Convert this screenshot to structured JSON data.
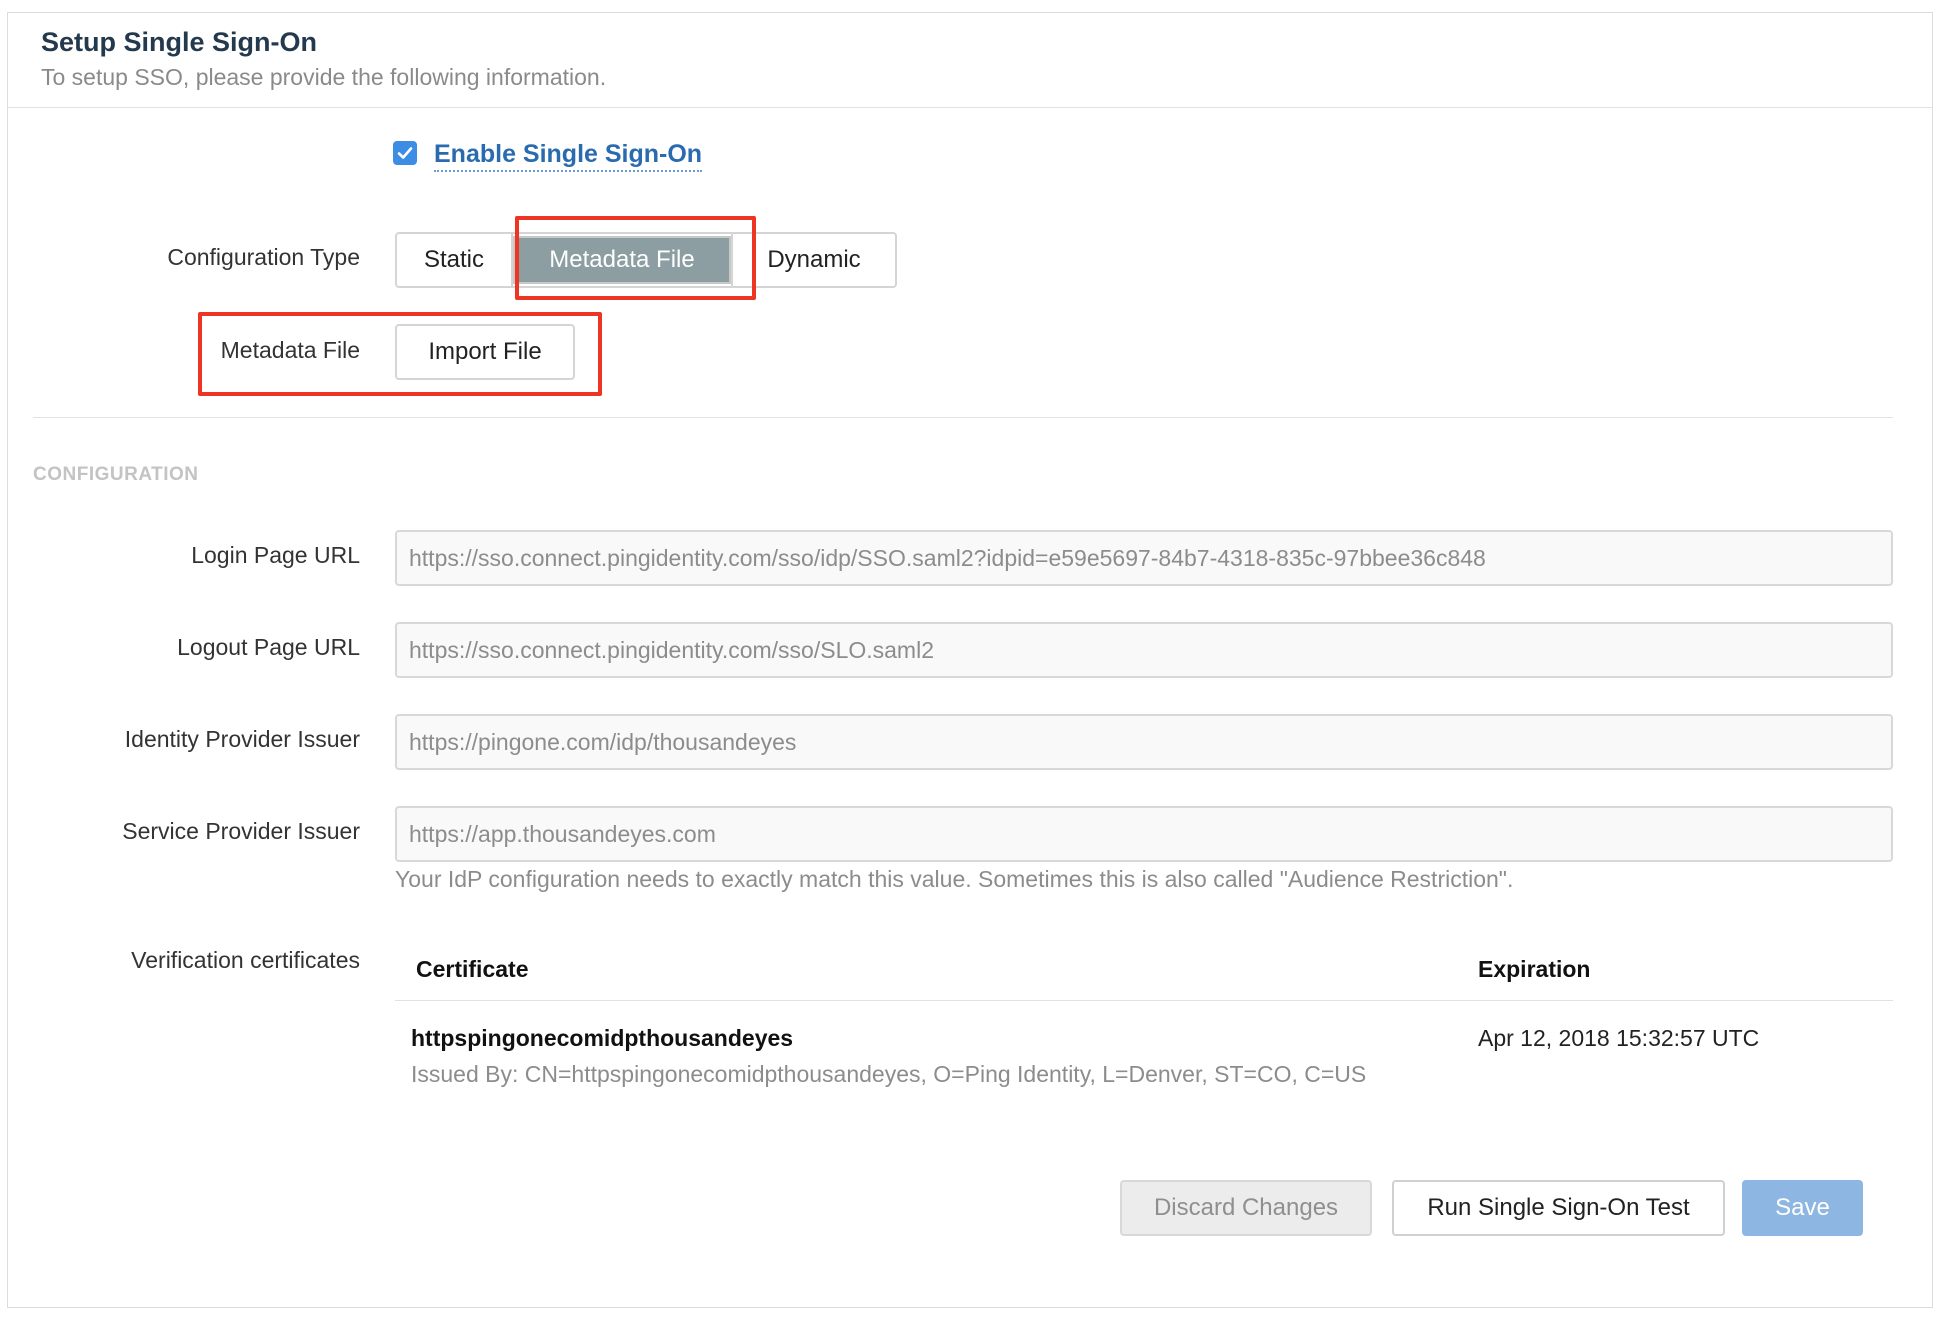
{
  "header": {
    "title": "Setup Single Sign-On",
    "subtitle": "To setup SSO, please provide the following information."
  },
  "enable_sso": {
    "label": "Enable Single Sign-On",
    "checked": true
  },
  "configuration_type": {
    "label": "Configuration Type",
    "options": [
      "Static",
      "Metadata File",
      "Dynamic"
    ],
    "selected": "Metadata File"
  },
  "metadata_file": {
    "label": "Metadata File",
    "button_label": "Import File"
  },
  "configuration": {
    "section_title": "CONFIGURATION",
    "login_page_url": {
      "label": "Login Page URL",
      "value": "https://sso.connect.pingidentity.com/sso/idp/SSO.saml2?idpid=e59e5697-84b7-4318-835c-97bbee36c848"
    },
    "logout_page_url": {
      "label": "Logout Page URL",
      "value": "https://sso.connect.pingidentity.com/sso/SLO.saml2"
    },
    "identity_provider_issuer": {
      "label": "Identity Provider Issuer",
      "value": "https://pingone.com/idp/thousandeyes"
    },
    "service_provider_issuer": {
      "label": "Service Provider Issuer",
      "value": "https://app.thousandeyes.com",
      "help": "Your IdP configuration needs to exactly match this value. Sometimes this is also called \"Audience Restriction\"."
    }
  },
  "certificates": {
    "label": "Verification certificates",
    "columns": [
      "Certificate",
      "Expiration"
    ],
    "rows": [
      {
        "name": "httpspingonecomidpthousandeyes",
        "issuer": "Issued By: CN=httpspingonecomidpthousandeyes, O=Ping Identity, L=Denver, ST=CO, C=US",
        "expiration": "Apr 12, 2018 15:32:57 UTC"
      }
    ]
  },
  "actions": {
    "discard_label": "Discard Changes",
    "test_label": "Run Single Sign-On Test",
    "save_label": "Save"
  },
  "colors": {
    "accent": "#3d8de5",
    "selected_segment": "#8c9ea2",
    "highlight": "#ee3524",
    "save_button": "#8db6e2"
  }
}
